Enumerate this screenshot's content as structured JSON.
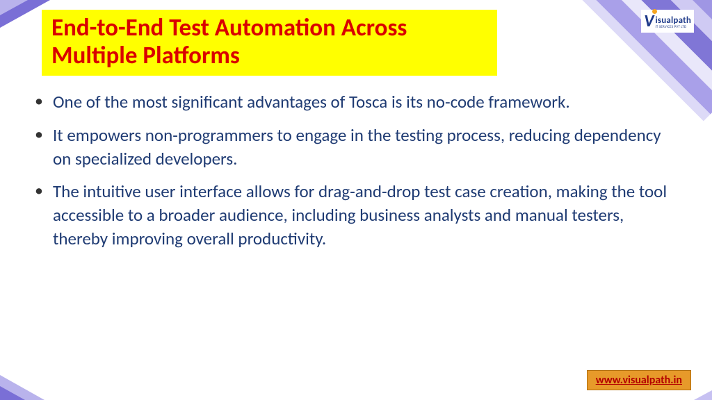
{
  "logo": {
    "mark": "V",
    "brand": "isualpath",
    "tagline": "IT SERVICES PVT LTD"
  },
  "title": "End-to-End Test Automation Across Multiple Platforms",
  "bullets": [
    "One of the most significant advantages of Tosca is its no-code framework.",
    "It empowers non-programmers to engage in the testing process, reducing dependency on specialized developers.",
    "The intuitive user interface allows for drag-and-drop test case creation, making the tool accessible to a broader audience, including business analysts and manual testers, thereby improving overall productivity."
  ],
  "footer": {
    "url_text": "www.visualpath.in"
  }
}
